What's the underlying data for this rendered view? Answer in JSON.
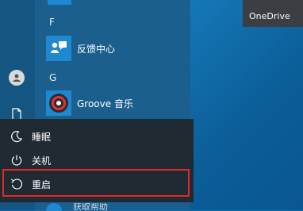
{
  "start_menu": {
    "groups": [
      {
        "letter": "F",
        "apps": [
          {
            "label": "反馈中心",
            "icon": "feedback-hub-icon"
          }
        ]
      },
      {
        "letter": "G",
        "apps": [
          {
            "label": "Groove 音乐",
            "icon": "groove-music-icon"
          }
        ]
      }
    ],
    "partial_bottom_app": "获取帮助"
  },
  "power_menu": {
    "items": [
      {
        "label": "睡眠",
        "icon": "moon-icon"
      },
      {
        "label": "关机",
        "icon": "power-icon"
      },
      {
        "label": "重启",
        "icon": "restart-icon"
      }
    ]
  },
  "tiles": {
    "onedrive_label": "OneDrive"
  },
  "colors": {
    "desktop": "#0e6aa6",
    "start_menu": "#1a5f8e",
    "tile_blue": "#1e88d0",
    "power_panel": "#1f2a33",
    "highlight": "#e02a2a"
  }
}
